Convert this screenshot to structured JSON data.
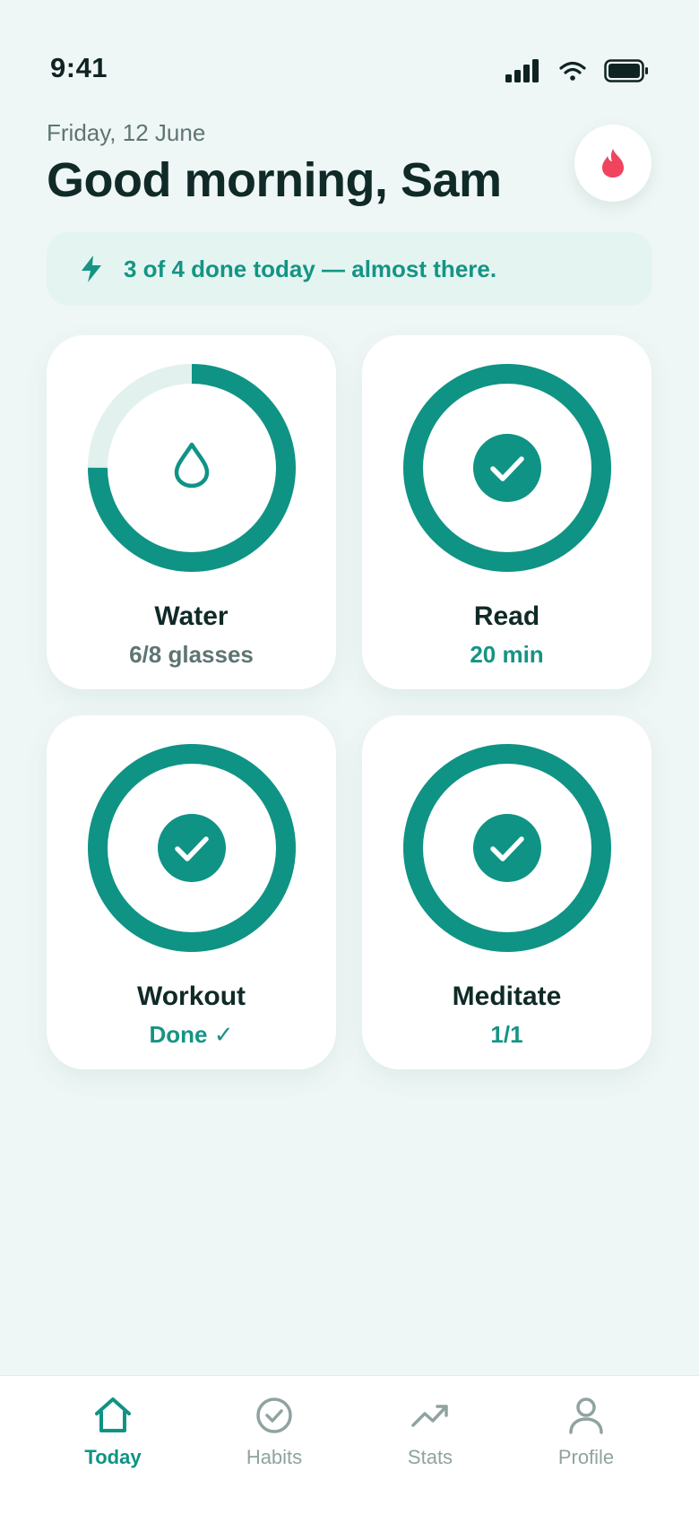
{
  "status": {
    "time": "9:41"
  },
  "header": {
    "date": "Friday, 12 June",
    "greeting": "Good morning, Sam"
  },
  "banner": {
    "text": "3 of 4 done today — almost there."
  },
  "colors": {
    "accent": "#0f9384",
    "track": "#e3f1ee",
    "streak": "#f0435e",
    "background": "#eff7f6"
  },
  "habits": [
    {
      "name": "Water",
      "value": "6/8 glasses",
      "progress": 0.75,
      "icon": "water-drop-icon"
    },
    {
      "name": "Read",
      "value": "20 min",
      "progress": 1.0,
      "icon": "check-icon"
    },
    {
      "name": "Workout",
      "value": "Done ✓",
      "progress": 1.0,
      "icon": "check-icon"
    },
    {
      "name": "Meditate",
      "value": "1/1",
      "progress": 1.0,
      "icon": "check-icon"
    }
  ],
  "tabs": [
    {
      "label": "Today",
      "icon": "home-icon",
      "active": true
    },
    {
      "label": "Habits",
      "icon": "check-circle-icon",
      "active": false
    },
    {
      "label": "Stats",
      "icon": "trend-up-icon",
      "active": false
    },
    {
      "label": "Profile",
      "icon": "person-icon",
      "active": false
    }
  ]
}
